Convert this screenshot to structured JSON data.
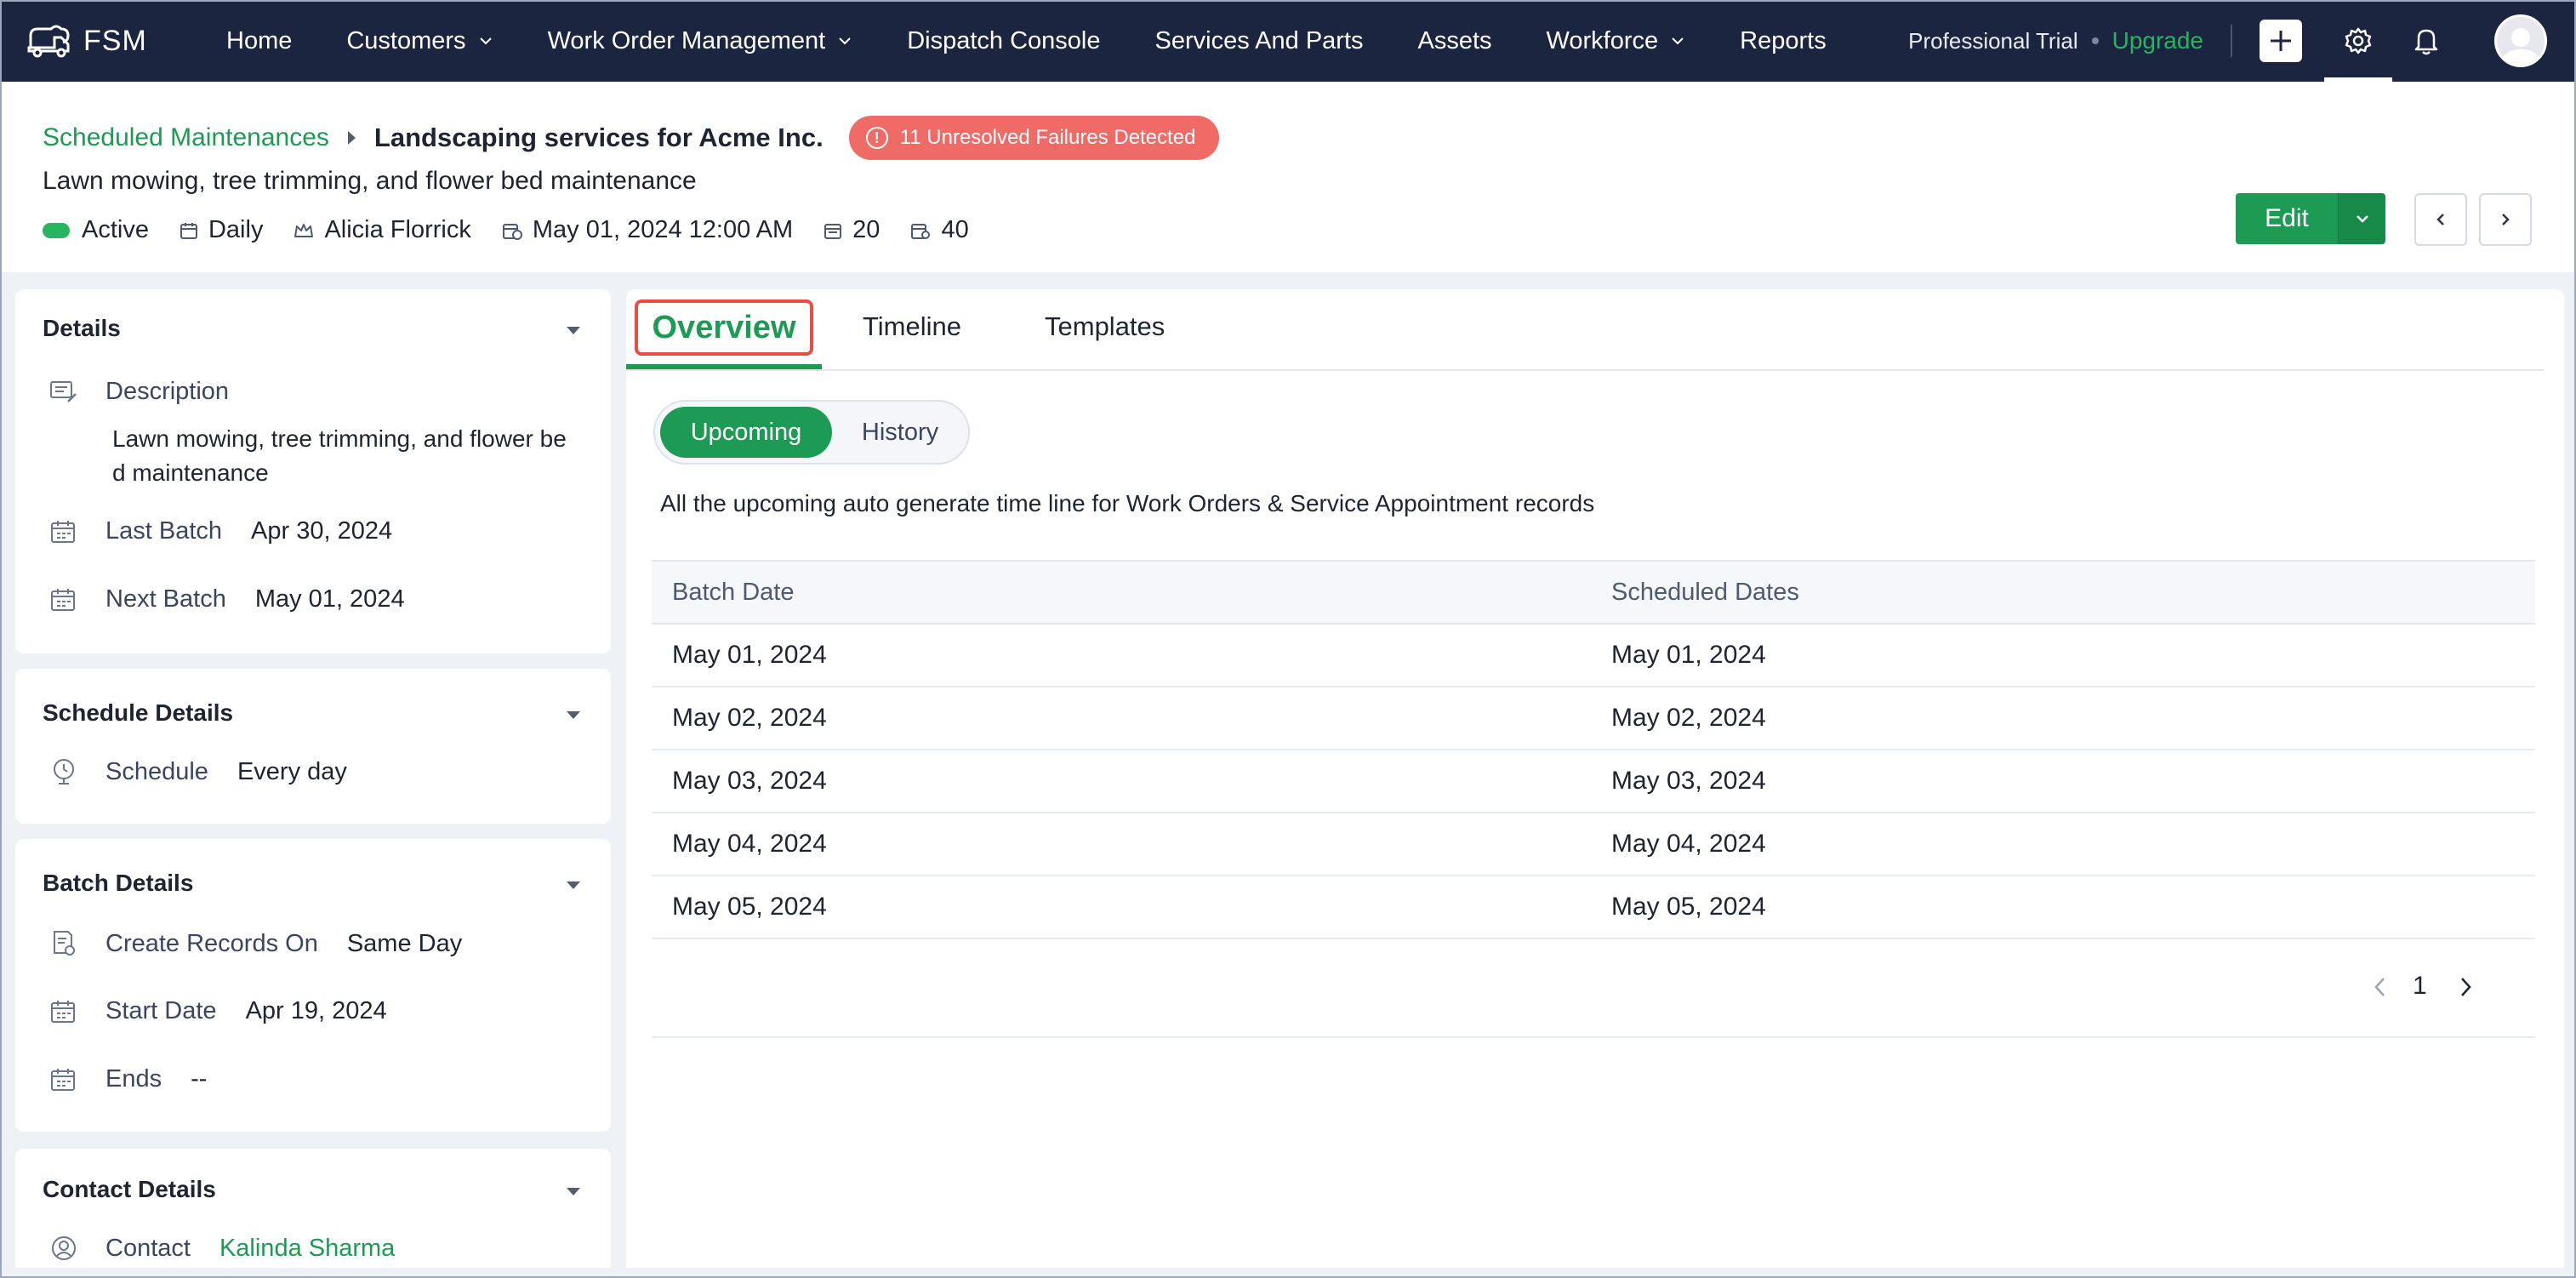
{
  "app": {
    "name": "FSM",
    "nav": [
      "Home",
      "Customers",
      "Work Order Management",
      "Dispatch Console",
      "Services And Parts",
      "Assets",
      "Workforce",
      "Reports"
    ],
    "trial_label": "Professional Trial",
    "upgrade_label": "Upgrade"
  },
  "record": {
    "breadcrumb": "Scheduled Maintenances",
    "title": "Landscaping services for Acme Inc.",
    "failure_badge": "11 Unresolved Failures Detected",
    "subtitle": "Lawn mowing, tree trimming, and flower bed maintenance",
    "meta": {
      "status": "Active",
      "frequency": "Daily",
      "owner": "Alicia Florrick",
      "datetime": "May 01, 2024 12:00 AM",
      "count_a": "20",
      "count_b": "40"
    },
    "edit_label": "Edit"
  },
  "sidebar": {
    "details": {
      "title": "Details",
      "description_label": "Description",
      "description_value": "Lawn mowing, tree trimming, and flower bed maintenance",
      "last_batch_label": "Last Batch",
      "last_batch_value": "Apr 30, 2024",
      "next_batch_label": "Next Batch",
      "next_batch_value": "May 01, 2024"
    },
    "schedule": {
      "title": "Schedule Details",
      "schedule_label": "Schedule",
      "schedule_value": "Every day"
    },
    "batch": {
      "title": "Batch Details",
      "create_label": "Create Records On",
      "create_value": "Same Day",
      "start_label": "Start Date",
      "start_value": "Apr 19, 2024",
      "ends_label": "Ends",
      "ends_value": "--"
    },
    "contact": {
      "title": "Contact Details",
      "contact_label": "Contact",
      "contact_value": "Kalinda Sharma"
    }
  },
  "main": {
    "tabs": [
      "Overview",
      "Timeline",
      "Templates"
    ],
    "segments": [
      "Upcoming",
      "History"
    ],
    "info": "All the upcoming auto generate time line for Work Orders & Service Appointment records",
    "columns": [
      "Batch Date",
      "Scheduled Dates"
    ],
    "rows": [
      [
        "May 01, 2024",
        "May 01, 2024"
      ],
      [
        "May 02, 2024",
        "May 02, 2024"
      ],
      [
        "May 03, 2024",
        "May 03, 2024"
      ],
      [
        "May 04, 2024",
        "May 04, 2024"
      ],
      [
        "May 05, 2024",
        "May 05, 2024"
      ]
    ],
    "page": "1"
  },
  "colors": {
    "navbar": "#1c2540",
    "accent_green": "#1d9a54",
    "badge_red": "#f06a66",
    "highlight_red": "#ea4d45"
  }
}
